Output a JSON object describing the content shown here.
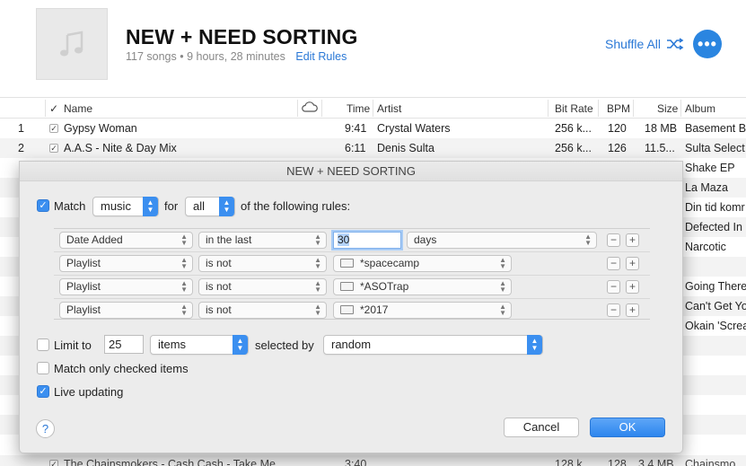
{
  "header": {
    "title": "NEW + NEED SORTING",
    "meta": "117 songs • 9 hours, 28 minutes",
    "edit_rules": "Edit Rules",
    "shuffle_label": "Shuffle All",
    "more_label": "•••"
  },
  "columns": {
    "check": "✓",
    "name": "Name",
    "time": "Time",
    "artist": "Artist",
    "bitrate": "Bit Rate",
    "bpm": "BPM",
    "size": "Size",
    "album": "Album"
  },
  "rows": [
    {
      "num": "1",
      "name": "Gypsy Woman",
      "time": "9:41",
      "artist": "Crystal Waters",
      "bitrate": "256 k...",
      "bpm": "120",
      "size": "18 MB",
      "album": "Basement B"
    },
    {
      "num": "2",
      "name": "A.A.S - Nite & Day Mix",
      "time": "6:11",
      "artist": "Denis Sulta",
      "bitrate": "256 k...",
      "bpm": "126",
      "size": "11.5...",
      "album": "Sulta Select"
    },
    {
      "album": "Shake EP"
    },
    {
      "album": "La Maza"
    },
    {
      "album": "Din tid komr"
    },
    {
      "album": "Defected In"
    },
    {
      "album": "Narcotic"
    },
    {
      "album": ""
    },
    {
      "album": "Going There"
    },
    {
      "album": "Can't Get Yo"
    },
    {
      "album": "Okain 'Screa"
    }
  ],
  "bottom_row": {
    "name": "The Chainsmokers - Cash Cash - Take Me",
    "time": "3:40",
    "bitrate": "128 k",
    "bpm": "128",
    "size": "3.4 MB",
    "album": "Chainsmo"
  },
  "dialog": {
    "title": "NEW + NEED SORTING",
    "match_label": "Match",
    "match_value": "music",
    "for_label": "for",
    "for_value": "all",
    "following": "of the following rules:",
    "rules": [
      {
        "field": "Date Added",
        "op": "in the last",
        "value": "30",
        "unit": "days"
      },
      {
        "field": "Playlist",
        "op": "is not",
        "value": "*spacecamp"
      },
      {
        "field": "Playlist",
        "op": "is not",
        "value": "*ASOTrap"
      },
      {
        "field": "Playlist",
        "op": "is not",
        "value": "*2017"
      }
    ],
    "limit_label": "Limit to",
    "limit_value": "25",
    "limit_unit": "items",
    "selected_by_label": "selected by",
    "selected_by_value": "random",
    "match_checked_label": "Match only checked items",
    "live_updating_label": "Live updating",
    "help": "?",
    "cancel": "Cancel",
    "ok": "OK",
    "states": {
      "match": true,
      "limit": false,
      "match_checked": false,
      "live_updating": true
    }
  }
}
